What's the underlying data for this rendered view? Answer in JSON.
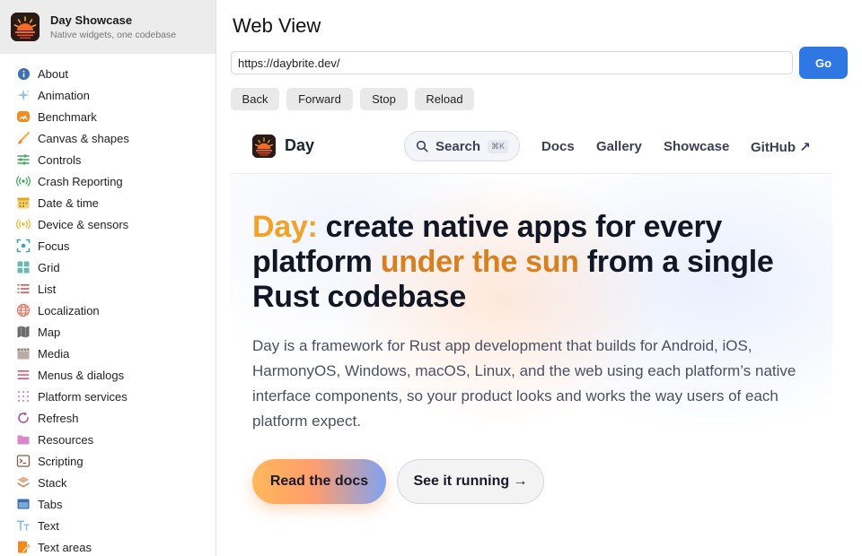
{
  "app": {
    "title": "Day Showcase",
    "subtitle": "Native widgets, one codebase"
  },
  "sidebar": {
    "items": [
      {
        "label": "About",
        "icon": "info-icon",
        "color": "#3d6fb5"
      },
      {
        "label": "Animation",
        "icon": "sparkles-icon",
        "color": "#7fb3e8"
      },
      {
        "label": "Benchmark",
        "icon": "speedometer-icon",
        "color": "#f08a1c"
      },
      {
        "label": "Canvas & shapes",
        "icon": "brush-icon",
        "color": "#f0a020"
      },
      {
        "label": "Controls",
        "icon": "sliders-icon",
        "color": "#3aa655"
      },
      {
        "label": "Crash Reporting",
        "icon": "broadcast-icon",
        "color": "#3aa655"
      },
      {
        "label": "Date & time",
        "icon": "calendar-icon",
        "color": "#e0a81c"
      },
      {
        "label": "Device & sensors",
        "icon": "sensor-icon",
        "color": "#e6b820"
      },
      {
        "label": "Focus",
        "icon": "focus-icon",
        "color": "#3aa8a0"
      },
      {
        "label": "Grid",
        "icon": "grid-icon",
        "color": "#5fb0a8"
      },
      {
        "label": "List",
        "icon": "list-icon",
        "color": "#e05050"
      },
      {
        "label": "Localization",
        "icon": "globe-icon",
        "color": "#e87060"
      },
      {
        "label": "Map",
        "icon": "map-icon",
        "color": "#6b6b6b"
      },
      {
        "label": "Media",
        "icon": "clapper-icon",
        "color": "#a89a90"
      },
      {
        "label": "Menus & dialogs",
        "icon": "menu-icon",
        "color": "#e05070"
      },
      {
        "label": "Platform services",
        "icon": "dots-grid-icon",
        "color": "#e88aa0"
      },
      {
        "label": "Refresh",
        "icon": "refresh-icon",
        "color": "#a04090"
      },
      {
        "label": "Resources",
        "icon": "folder-icon",
        "color": "#d888c8"
      },
      {
        "label": "Scripting",
        "icon": "terminal-icon",
        "color": "#8a5a40"
      },
      {
        "label": "Stack",
        "icon": "stack-icon",
        "color": "#c89070"
      },
      {
        "label": "Tabs",
        "icon": "tabs-icon",
        "color": "#3a6ea8"
      },
      {
        "label": "Text",
        "icon": "text-icon",
        "color": "#8ab8d8"
      },
      {
        "label": "Text areas",
        "icon": "edit-doc-icon",
        "color": "#f08a1c"
      }
    ]
  },
  "main": {
    "title": "Web View",
    "url_value": "https://daybrite.dev/",
    "go_label": "Go",
    "back_label": "Back",
    "forward_label": "Forward",
    "stop_label": "Stop",
    "reload_label": "Reload"
  },
  "site": {
    "name": "Day",
    "search_label": "Search",
    "search_shortcut": "⌘K",
    "links": [
      "Docs",
      "Gallery",
      "Showcase",
      "GitHub ↗"
    ],
    "headline_accent1": "Day:",
    "headline_part1": " create native apps for every platform ",
    "headline_accent2": "under the sun",
    "headline_part2": " from a single Rust codebase",
    "lede": "Day is a framework for Rust app development that builds for Android, iOS, HarmonyOS, Windows, macOS, Linux, and the web using each platform’s native interface components, so your product looks and works the way users of each platform expect.",
    "cta_primary": "Read the docs",
    "cta_secondary": "See it running →"
  },
  "colors": {
    "accent": "#2f78e4",
    "headline_accent1": "#f3a226",
    "headline_accent2": "#d8801f"
  }
}
